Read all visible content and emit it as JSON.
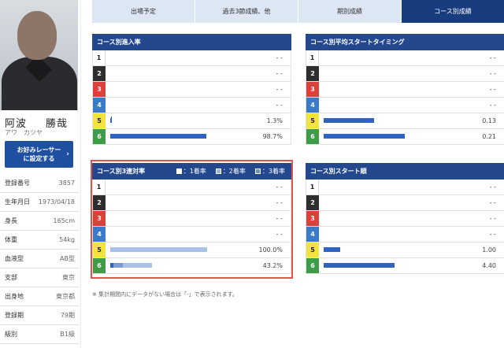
{
  "racer": {
    "name_family": "阿波",
    "name_given": "勝哉",
    "kana": "アワ　カツヤ",
    "favorite_button": "お好みレーサーに設定する",
    "info": [
      {
        "label": "登録番号",
        "value": "3857"
      },
      {
        "label": "生年月日",
        "value": "1973/04/18"
      },
      {
        "label": "身長",
        "value": "165cm"
      },
      {
        "label": "体重",
        "value": "54kg"
      },
      {
        "label": "血液型",
        "value": "AB型"
      },
      {
        "label": "支部",
        "value": "東京"
      },
      {
        "label": "出身地",
        "value": "東京都"
      },
      {
        "label": "登録期",
        "value": "79期"
      },
      {
        "label": "級別",
        "value": "B1級"
      }
    ]
  },
  "tabs": [
    {
      "label": "出場予定",
      "active": false
    },
    {
      "label": "過去3節成績、他",
      "active": false
    },
    {
      "label": "期別成績",
      "active": false
    },
    {
      "label": "コース別成績",
      "active": true
    }
  ],
  "panels": {
    "entry": {
      "title": "コース別進入率",
      "rows": [
        {
          "lane": "1",
          "value": "- -",
          "bar": 0,
          "tick": ""
        },
        {
          "lane": "2",
          "value": "- -",
          "bar": 0,
          "tick": ""
        },
        {
          "lane": "3",
          "value": "- -",
          "bar": 0,
          "tick": ""
        },
        {
          "lane": "4",
          "value": "- -",
          "bar": 0,
          "tick": ""
        },
        {
          "lane": "5",
          "value": "1.3%",
          "bar": 0.013,
          "tick": "!"
        },
        {
          "lane": "6",
          "value": "98.7%",
          "bar": 0.987,
          "tick": ""
        }
      ]
    },
    "timing": {
      "title": "コース別平均スタートタイミング",
      "rows": [
        {
          "lane": "1",
          "value": "- -",
          "bar": 0
        },
        {
          "lane": "2",
          "value": "- -",
          "bar": 0
        },
        {
          "lane": "3",
          "value": "- -",
          "bar": 0
        },
        {
          "lane": "4",
          "value": "- -",
          "bar": 0
        },
        {
          "lane": "5",
          "value": "0.13",
          "bar": 0.13
        },
        {
          "lane": "6",
          "value": "0.21",
          "bar": 0.21
        }
      ]
    },
    "top3": {
      "title": "コース別3連対率",
      "legend": [
        {
          "key": "one",
          "label": "：1着率"
        },
        {
          "key": "two",
          "label": "：2着率"
        },
        {
          "key": "three",
          "label": "：3着率"
        }
      ],
      "rows": [
        {
          "lane": "1",
          "value": "- -",
          "first": 0,
          "second": 0,
          "third": 0
        },
        {
          "lane": "2",
          "value": "- -",
          "first": 0,
          "second": 0,
          "third": 0
        },
        {
          "lane": "3",
          "value": "- -",
          "first": 0,
          "second": 0,
          "third": 0
        },
        {
          "lane": "4",
          "value": "- -",
          "first": 0,
          "second": 0,
          "third": 0
        },
        {
          "lane": "5",
          "value": "100.0%",
          "first": 0,
          "second": 0,
          "third": 1.0
        },
        {
          "lane": "6",
          "value": "43.2%",
          "first": 0.03,
          "second": 0.1,
          "third": 0.3
        }
      ]
    },
    "start_order": {
      "title": "コース別スタート順",
      "rows": [
        {
          "lane": "1",
          "value": "- -",
          "bar": 0
        },
        {
          "lane": "2",
          "value": "- -",
          "bar": 0
        },
        {
          "lane": "3",
          "value": "- -",
          "bar": 0
        },
        {
          "lane": "4",
          "value": "- -",
          "bar": 0
        },
        {
          "lane": "5",
          "value": "1.00",
          "bar": 1.0
        },
        {
          "lane": "6",
          "value": "4.40",
          "bar": 4.4
        }
      ]
    }
  },
  "note": "※ 集計期間内にデータがない場合は「-」で表示されます。",
  "colors": {
    "tab_active": "#173d7f",
    "tab_inactive": "#dde6f3",
    "panel_header": "#24488e",
    "bar": "#2f62c1",
    "highlight_border": "#e0554a"
  }
}
